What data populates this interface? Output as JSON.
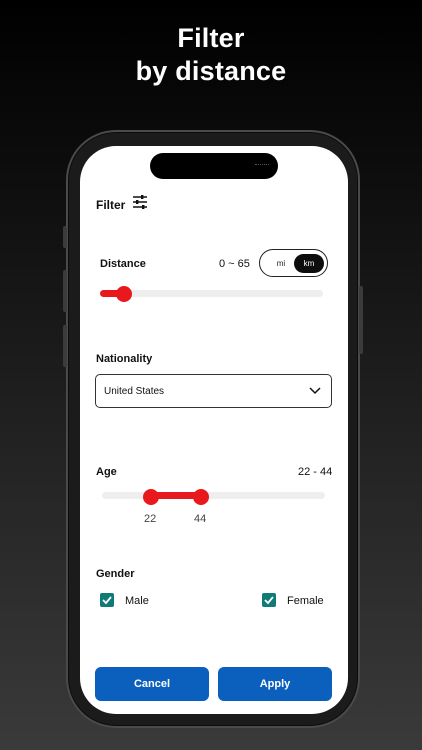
{
  "headline": {
    "line1": "Filter",
    "line2": "by distance"
  },
  "screen": {
    "title": "Filter",
    "title_icon": "sliders-icon",
    "distance": {
      "label": "Distance",
      "range_text": "0 ~ 65",
      "unit_options": [
        "mi",
        "km"
      ],
      "selected_unit": "km"
    },
    "nationality": {
      "label": "Nationality",
      "selected": "United States",
      "chevron_icon": "chevron-down-icon"
    },
    "age": {
      "label": "Age",
      "range_text": "22 - 44",
      "min_label": "22",
      "max_label": "44"
    },
    "gender": {
      "label": "Gender",
      "options": [
        {
          "label": "Male",
          "checked": true
        },
        {
          "label": "Female",
          "checked": true
        }
      ]
    },
    "buttons": {
      "cancel": "Cancel",
      "apply": "Apply"
    }
  },
  "colors": {
    "accent_red": "#e8181d",
    "button_blue": "#0b5fbd",
    "checkbox_teal": "#0f7a76"
  }
}
